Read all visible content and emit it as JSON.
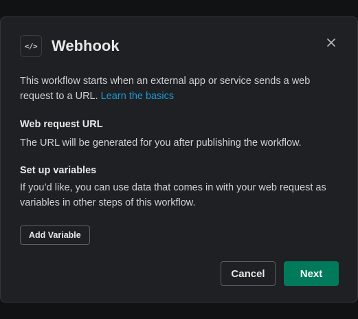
{
  "dialog": {
    "icon_name": "code-icon",
    "icon_glyph": "</>",
    "title": "Webhook",
    "close_icon_name": "close-icon"
  },
  "intro": {
    "text": "This workflow starts when an external app or service sends a web request to a URL. ",
    "link_label": "Learn the basics"
  },
  "web_request_url": {
    "heading": "Web request URL",
    "text": "The URL will be generated for you after publishing the workflow."
  },
  "variables": {
    "heading": "Set up variables",
    "text": "If you’d like, you can use data that comes in with your web request as variables in other steps of this workflow.",
    "add_button_label": "Add Variable"
  },
  "footer": {
    "cancel_label": "Cancel",
    "next_label": "Next"
  },
  "colors": {
    "modal_background": "#1f2023",
    "link": "#1d9bd1",
    "primary_button": "#007a5a"
  }
}
